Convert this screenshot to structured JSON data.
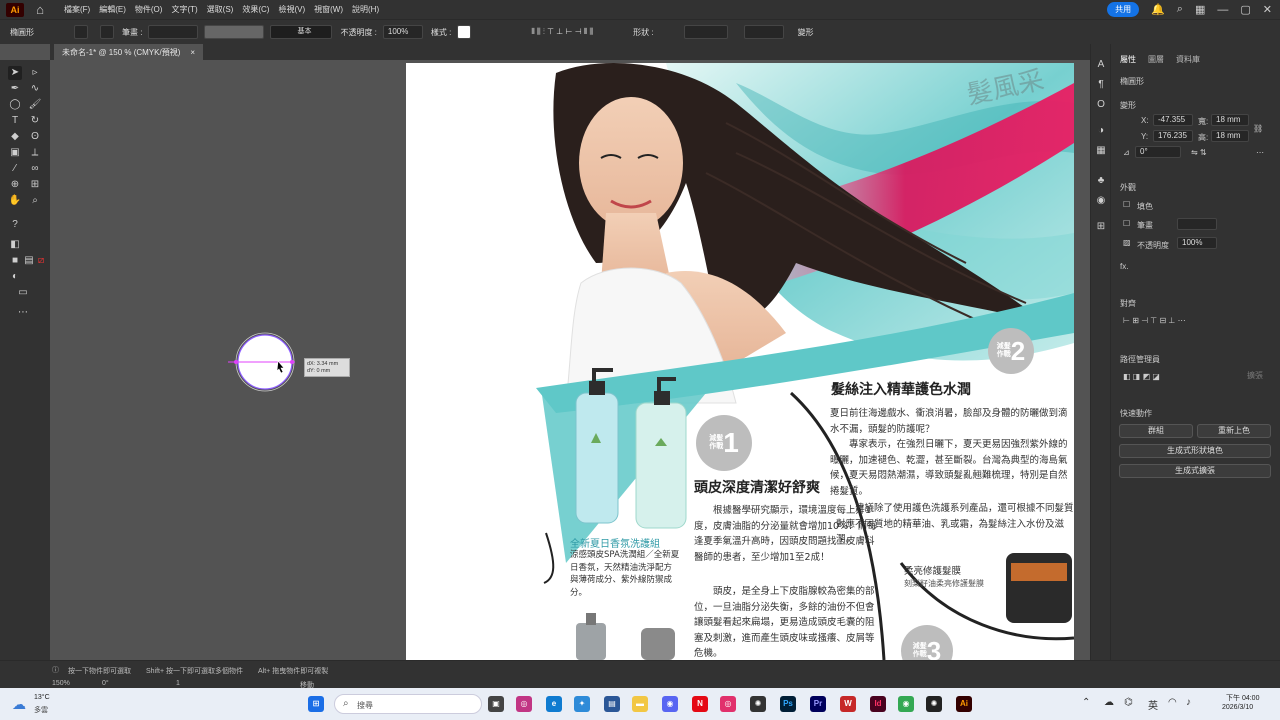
{
  "app": {
    "logo": "Ai",
    "share_label": "共用"
  },
  "menu": {
    "items": [
      "檔案(F)",
      "編輯(E)",
      "物件(O)",
      "文字(T)",
      "選取(S)",
      "效果(C)",
      "檢視(V)",
      "視窗(W)",
      "說明(H)"
    ]
  },
  "control": {
    "selection_label": "橢圓形",
    "stroke_label": "筆畫 :",
    "stroke_style": "基本",
    "opacity_label": "不透明度 :",
    "opacity_value": "100%",
    "style_label": "樣式 :",
    "shape_label": "形狀 :",
    "transform_label": "變形"
  },
  "document": {
    "tab_title": "未命名-1* @ 150 % (CMYK/預視)"
  },
  "smart_guide": {
    "dx": "dX: 3.34 mm",
    "dy": "dY: 0 mm"
  },
  "panel": {
    "tabs": [
      "屬性",
      "圖層",
      "資料庫"
    ],
    "selection_type": "橢圓形",
    "transform_title": "變形",
    "x_label": "X:",
    "x_value": "-47.355",
    "y_label": "Y:",
    "y_value": "176.235",
    "w_label": "寬:",
    "w_value": "18 mm",
    "h_label": "高:",
    "h_value": "18 mm",
    "angle_value": "0°",
    "appearance_title": "外觀",
    "fill_label": "填色",
    "stroke_label": "筆畫",
    "opacity_label": "不透明度",
    "opacity_value": "100%",
    "fx_label": "fx.",
    "align_title": "對齊",
    "pathfinder_title": "路徑管理員",
    "expand_label": "擴張",
    "quick_actions_title": "快速動作",
    "group_button": "群組",
    "recolor_button": "重新上色",
    "shape_fill_button": "生成式形狀填色",
    "expand_button": "生成式擴張"
  },
  "status": {
    "hint1": "按一下物件即可選取",
    "hint2": "Shift+ 按一下即可選取多個物件",
    "hint3": "Alt+ 拖曳物件即可複製",
    "zoom": "150%",
    "rotate": "0°",
    "artboard": "1",
    "mode": "移動"
  },
  "taskbar": {
    "weather_temp": "13°C",
    "weather_desc": "多雲",
    "search_placeholder": "搜尋",
    "ime": "英",
    "time": "下午 04:00",
    "date": "2026/3/10"
  },
  "artboard": {
    "banner_text": "髮風采",
    "headline_main": "髮絲注入精華護色水潤",
    "para_main_1": "夏日前往海邊戲水、衝浪消暑，臉部及身體的防曬做到滴水不漏，頭髮的防護呢？",
    "para_main_2": "專家表示，在強烈日曬下，夏天更易因強烈紫外線的曝曬，加速褪色、乾澀，甚至斷裂。台灣為典型的海島氣候，夏天易悶熱潮濕，導致頭髮亂翹難梳理，特別是自然捲髮質。",
    "para_main_3": "建議除了使用護色洗護系列產品，還可根據不同髮質對應不同質地的精華油、乳或霜，為髮絲注入水份及滋潤。",
    "headline_1": "頭皮深度清潔好舒爽",
    "para_1a": "根據醫學研究顯示，環境溫度每上升1度，皮膚油脂的分泌量就會增加10%！而每逢夏季氣溫升高時，因頭皮問題找上皮膚科醫師的患者，至少增加1至2成！",
    "para_1b": "頭皮，是全身上下皮脂腺較為密集的部位，一旦油脂分泌失衡，多餘的油份不但會讓頭髮看起來扁塌，更易造成頭皮毛囊的阻塞及刺激，進而產生頭皮味或搔癢、皮屑等危機。",
    "badge_1_label": "減髮作戰",
    "badge_1_num": "1",
    "badge_2_label": "減髮作戰",
    "badge_2_num": "2",
    "badge_3_label": "減髮作戰",
    "badge_3_num": "3",
    "product_1_title": "全新夏日香氛洗護組",
    "product_1_desc": "涼感頭皮SPA洗潤組／全新夏日香氛，天然精油洗淨配方與薄荷成分、紫外線防禦成分。",
    "product_2_title": "柔亮修護髮膜",
    "product_2_desc": "刻梨籽油柔亮修護髮膜"
  },
  "colors": {
    "accent": "#1473e6",
    "magenta": "#d81b60",
    "teal": "#5fc8c8"
  }
}
